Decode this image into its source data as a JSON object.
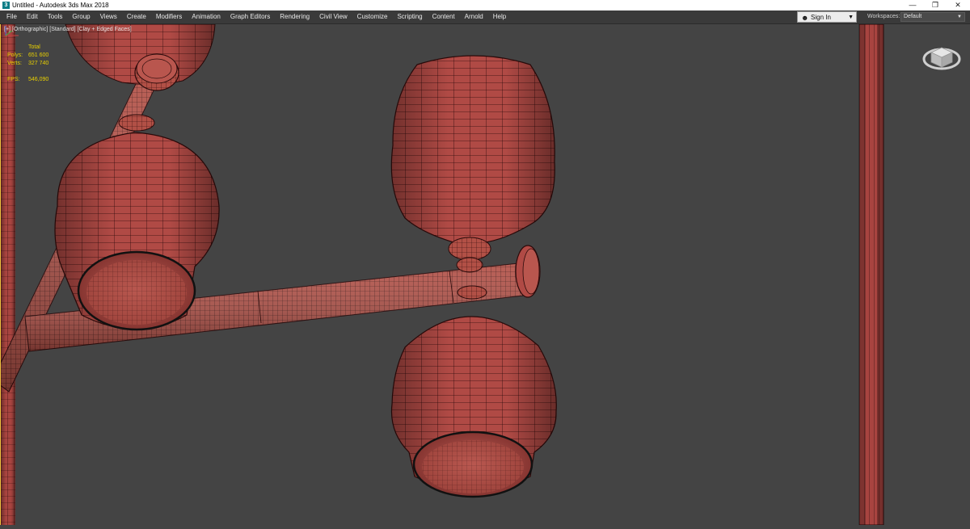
{
  "window": {
    "title": "Untitled - Autodesk 3ds Max 2018",
    "app_icon": "3ds-max-logo-icon",
    "controls": [
      "minimize-icon",
      "restore-icon",
      "close-icon"
    ]
  },
  "menubar": {
    "items": [
      "File",
      "Edit",
      "Tools",
      "Group",
      "Views",
      "Create",
      "Modifiers",
      "Animation",
      "Graph Editors",
      "Rendering",
      "Civil View",
      "Customize",
      "Scripting",
      "Content",
      "Arnold",
      "Help"
    ],
    "signin": {
      "label": "Sign In",
      "icon": "user-icon"
    },
    "workspaces": {
      "label": "Workspaces:",
      "value": "Default"
    }
  },
  "viewport": {
    "label": {
      "plus": "[+]",
      "view": "[Orthographic]",
      "shading_preset": "[Standard]",
      "shading_mode": "[Clay + Edged Faces]"
    },
    "stats": {
      "header": "Total",
      "polys_label": "Polys:",
      "polys_value": "651 600",
      "verts_label": "Verts:",
      "verts_value": "327 740",
      "fps_label": "FPS:",
      "fps_value": "546,090"
    },
    "colors": {
      "background": "#444444",
      "clay": "#b04a45",
      "wire": "#2a0a0a",
      "stats_text": "#e8d000"
    }
  }
}
